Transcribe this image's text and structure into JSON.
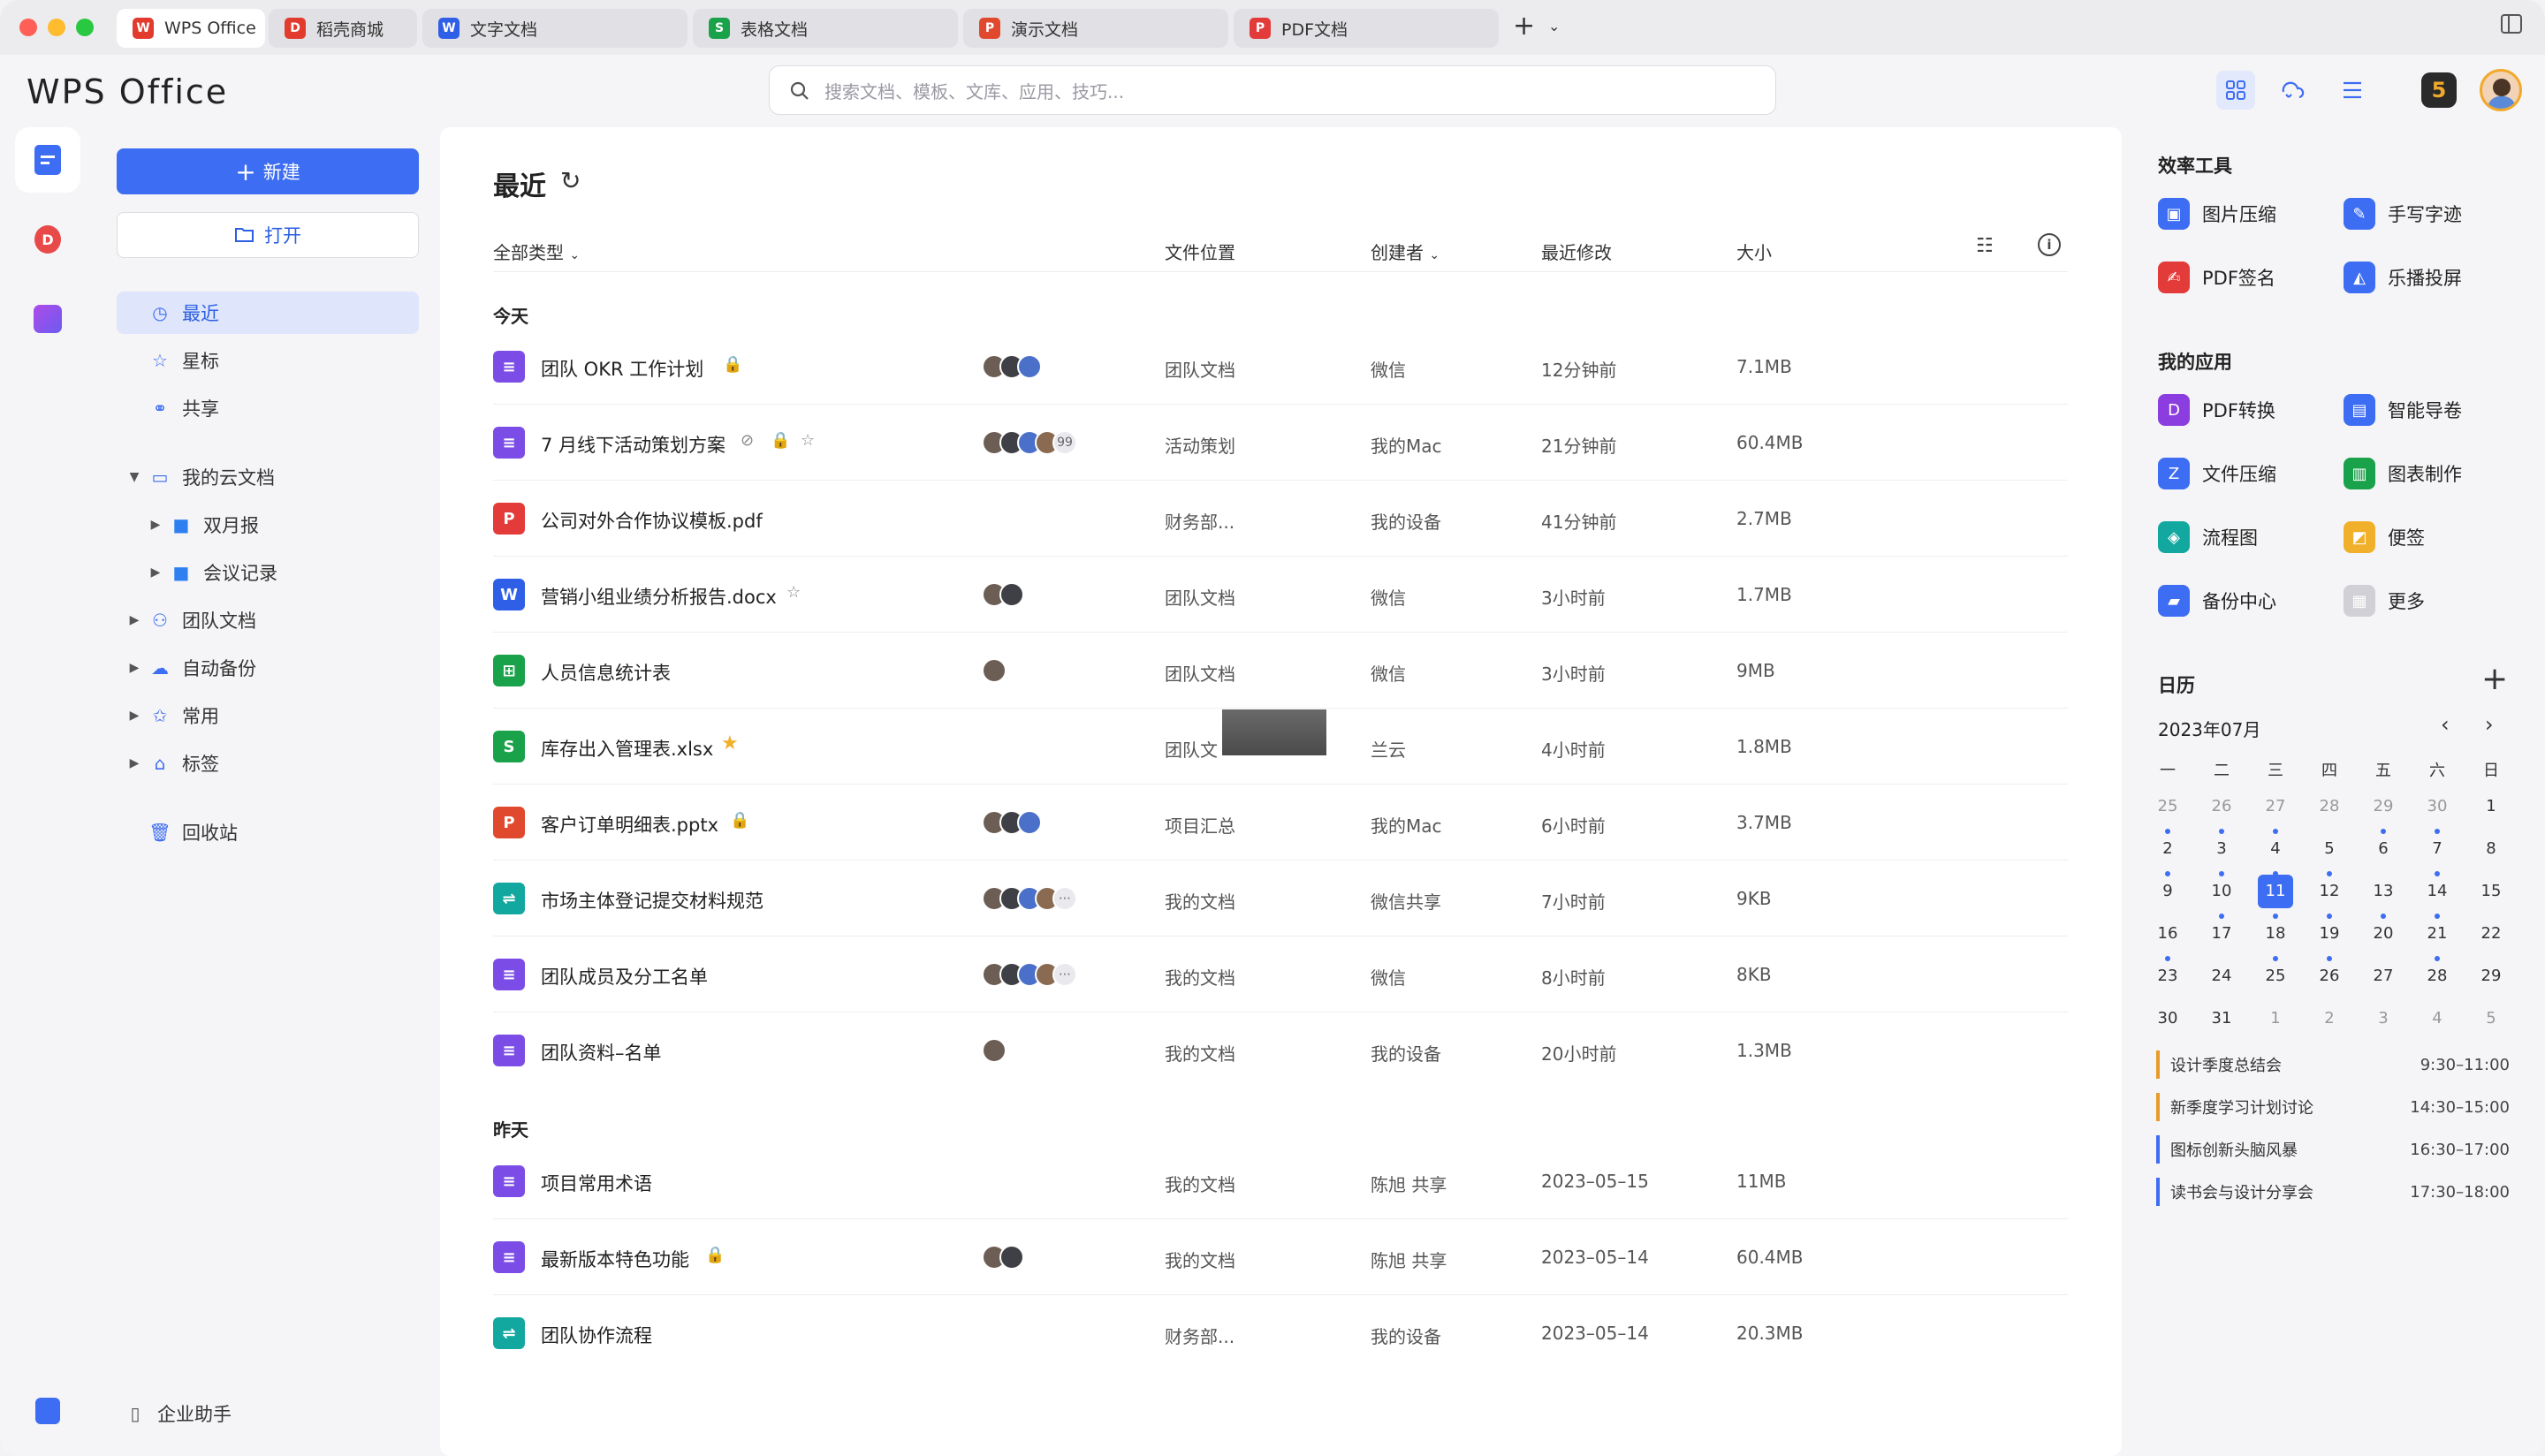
{
  "tabs": [
    {
      "label": "WPS Office",
      "icon": "W",
      "color": "#e23b2e"
    },
    {
      "label": "稻壳商城",
      "icon": "D",
      "color": "#e23b2e"
    },
    {
      "label": "文字文档",
      "icon": "W",
      "color": "#2f5fe7"
    },
    {
      "label": "表格文档",
      "icon": "S",
      "color": "#1aa24a"
    },
    {
      "label": "演示文档",
      "icon": "P",
      "color": "#e0492d"
    },
    {
      "label": "PDF文档",
      "icon": "P",
      "color": "#e33a3a"
    }
  ],
  "app": {
    "logo": "WPS Office"
  },
  "search": {
    "placeholder": "搜索文档、模板、文库、应用、技巧..."
  },
  "sidebar": {
    "new_label": "新建",
    "open_label": "打开",
    "items": [
      {
        "label": "最近"
      },
      {
        "label": "星标"
      },
      {
        "label": "共享"
      },
      {
        "label": "我的云文档"
      },
      {
        "label": "双月报"
      },
      {
        "label": "会议记录"
      },
      {
        "label": "团队文档"
      },
      {
        "label": "自动备份"
      },
      {
        "label": "常用"
      },
      {
        "label": "标签"
      },
      {
        "label": "回收站"
      }
    ],
    "footer": "企业助手"
  },
  "main": {
    "title": "最近",
    "filter": "全部类型",
    "columns": {
      "location": "文件位置",
      "creator": "创建者",
      "modified": "最近修改",
      "size": "大小"
    },
    "sections": {
      "today": "今天",
      "yesterday": "昨天"
    },
    "rows": [
      {
        "name": "团队 OKR 工作计划",
        "icon": "doc",
        "loc": "团队文档",
        "creator": "微信",
        "time": "12分钟前",
        "size": "7.1MB"
      },
      {
        "name": "7 月线下活动策划方案",
        "icon": "doc",
        "loc": "活动策划",
        "creator": "我的Mac",
        "time": "21分钟前",
        "size": "60.4MB",
        "count": "99"
      },
      {
        "name": "公司对外合作协议模板.pdf",
        "icon": "pdf",
        "loc": "财务部...",
        "creator": "我的设备",
        "time": "41分钟前",
        "size": "2.7MB"
      },
      {
        "name": "营销小组业绩分析报告.docx",
        "icon": "word",
        "loc": "团队文档",
        "creator": "微信",
        "time": "3小时前",
        "size": "1.7MB"
      },
      {
        "name": "人员信息统计表",
        "icon": "table",
        "loc": "团队文档",
        "creator": "微信",
        "time": "3小时前",
        "size": "9MB"
      },
      {
        "name": "库存出入管理表.xlsx",
        "icon": "sheet",
        "loc": "团队文",
        "creator": "兰云",
        "time": "4小时前",
        "size": "1.8MB"
      },
      {
        "name": "客户订单明细表.pptx",
        "icon": "ppt",
        "loc": "项目汇总",
        "creator": "我的Mac",
        "time": "6小时前",
        "size": "3.7MB"
      },
      {
        "name": "市场主体登记提交材料规范",
        "icon": "flow",
        "loc": "我的文档",
        "creator": "微信共享",
        "time": "7小时前",
        "size": "9KB"
      },
      {
        "name": "团队成员及分工名单",
        "icon": "doc",
        "loc": "我的文档",
        "creator": "微信",
        "time": "8小时前",
        "size": "8KB"
      },
      {
        "name": "团队资料–名单",
        "icon": "doc",
        "loc": "我的文档",
        "creator": "我的设备",
        "time": "20小时前",
        "size": "1.3MB"
      },
      {
        "name": "项目常用术语",
        "icon": "doc",
        "loc": "我的文档",
        "creator": "陈旭 共享",
        "time": "2023–05–15",
        "size": "11MB"
      },
      {
        "name": "最新版本特色功能",
        "icon": "doc",
        "loc": "我的文档",
        "creator": "陈旭 共享",
        "time": "2023–05–14",
        "size": "60.4MB"
      },
      {
        "name": "团队协作流程",
        "icon": "flow",
        "loc": "财务部...",
        "creator": "我的设备",
        "time": "2023–05–14",
        "size": "20.3MB"
      }
    ]
  },
  "rpanel": {
    "tools_title": "效率工具",
    "tools": [
      {
        "label": "图片压缩",
        "color": "#3d6df2"
      },
      {
        "label": "手写字迹",
        "color": "#3d6df2"
      },
      {
        "label": "PDF签名",
        "color": "#e33a3a"
      },
      {
        "label": "乐播投屏",
        "color": "#3d6df2"
      }
    ],
    "apps_title": "我的应用",
    "apps": [
      {
        "label": "PDF转换",
        "color": "#8b3de0"
      },
      {
        "label": "智能导卷",
        "color": "#3d6df2"
      },
      {
        "label": "文件压缩",
        "color": "#3d6df2"
      },
      {
        "label": "图表制作",
        "color": "#1aa24a"
      },
      {
        "label": "流程图",
        "color": "#12a8a0"
      },
      {
        "label": "便签",
        "color": "#f0b02a"
      },
      {
        "label": "备份中心",
        "color": "#3d6df2"
      },
      {
        "label": "更多",
        "color": "#c7c7cc"
      }
    ],
    "calendar": {
      "title": "日历",
      "month": "2023年07月",
      "weekdays": [
        "一",
        "二",
        "三",
        "四",
        "五",
        "六",
        "日"
      ],
      "days": [
        "25",
        "26",
        "27",
        "28",
        "29",
        "30",
        "1",
        "2",
        "3",
        "4",
        "5",
        "6",
        "7",
        "8",
        "9",
        "10",
        "11",
        "12",
        "13",
        "14",
        "15",
        "16",
        "17",
        "18",
        "19",
        "20",
        "21",
        "22",
        "23",
        "24",
        "25",
        "26",
        "27",
        "28",
        "29",
        "30",
        "31",
        "1",
        "2",
        "3",
        "4",
        "5"
      ]
    },
    "events": [
      {
        "title": "设计季度总结会",
        "time": "9:30–11:00",
        "color": "#e89b2a"
      },
      {
        "title": "新季度学习计划讨论",
        "time": "14:30–15:00",
        "color": "#e89b2a"
      },
      {
        "title": "图标创新头脑风暴",
        "time": "16:30–17:00",
        "color": "#3d6df2"
      },
      {
        "title": "读书会与设计分享会",
        "time": "17:30–18:00",
        "color": "#3d6df2"
      }
    ]
  }
}
